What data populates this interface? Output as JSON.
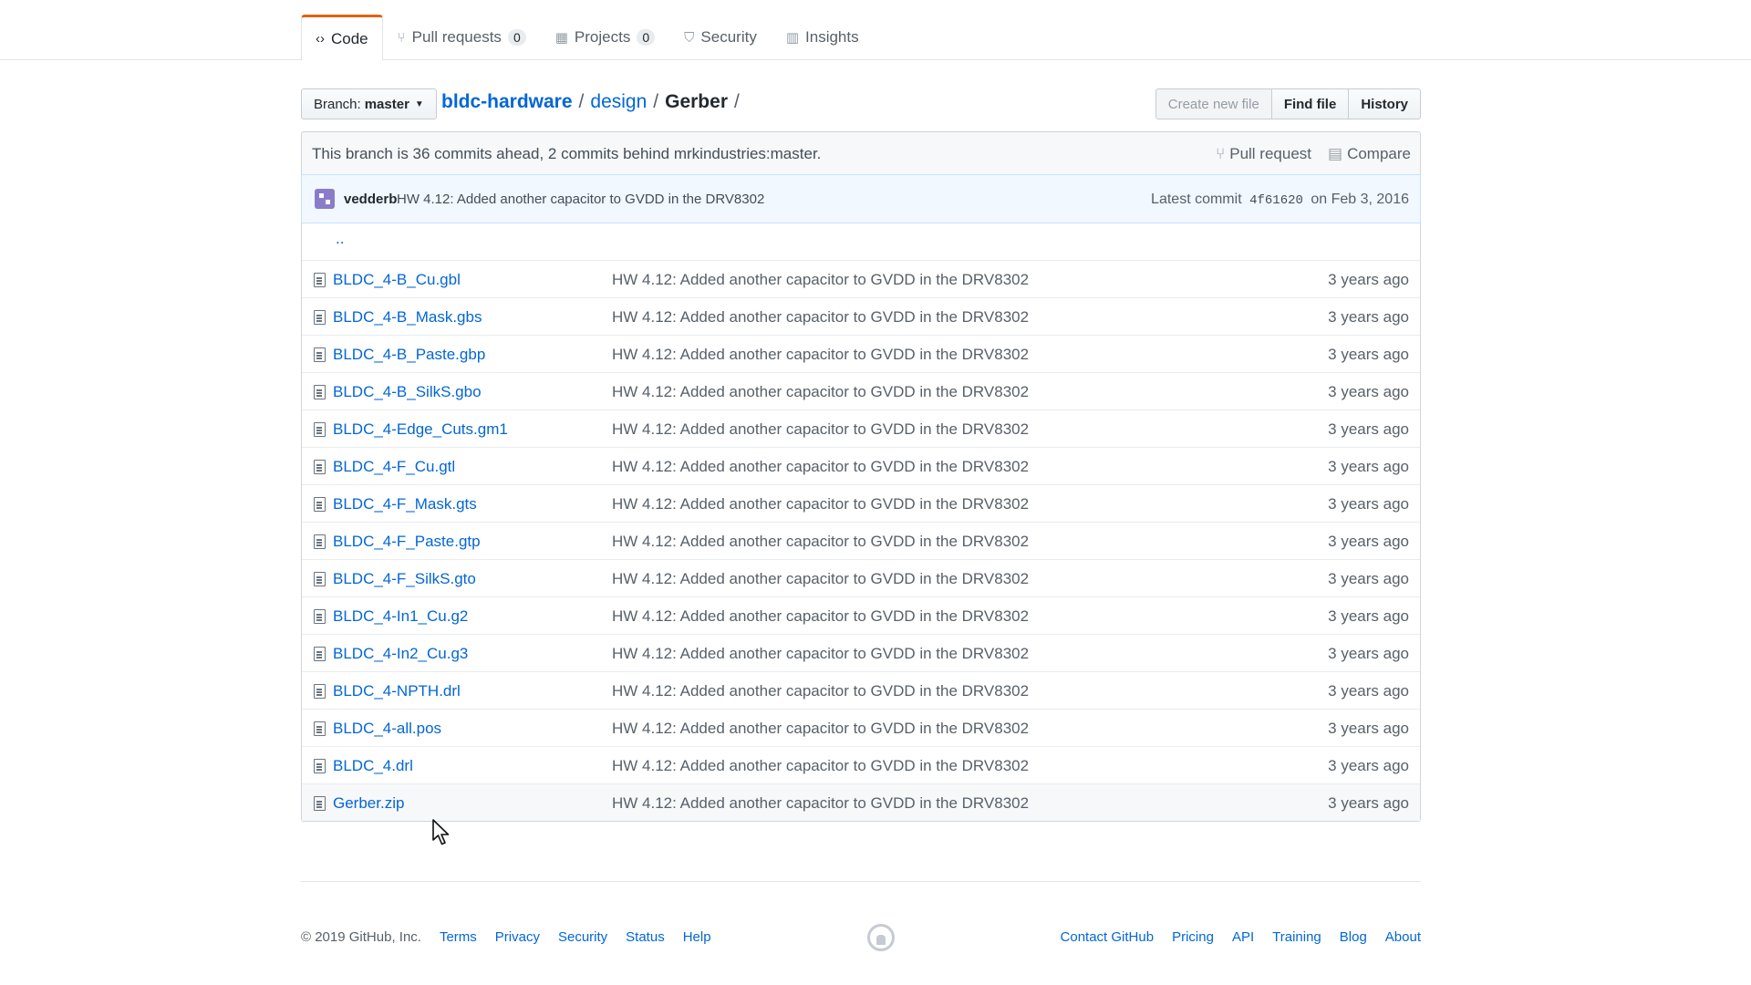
{
  "nav": {
    "tabs": [
      {
        "label": "Code",
        "icon": "code-icon",
        "glyph": "‹›"
      },
      {
        "label": "Pull requests",
        "count": "0",
        "icon": "pull-request-icon",
        "glyph": "⑂"
      },
      {
        "label": "Projects",
        "count": "0",
        "icon": "project-icon",
        "glyph": "▦"
      },
      {
        "label": "Security",
        "icon": "shield-icon",
        "glyph": "⛉"
      },
      {
        "label": "Insights",
        "icon": "graph-icon",
        "glyph": "▥"
      }
    ]
  },
  "file_nav": {
    "branch_prefix": "Branch:",
    "branch_name": "master",
    "breadcrumb": {
      "repo": "bldc-hardware",
      "folder": "design",
      "current": "Gerber",
      "separator": "/"
    },
    "buttons": {
      "create": "Create new file",
      "find": "Find file",
      "history": "History"
    }
  },
  "branch_info": {
    "message": "This branch is 36 commits ahead, 2 commits behind mrkindustries:master.",
    "pull_request": "Pull request",
    "compare": "Compare"
  },
  "commit": {
    "author": "vedderb",
    "message": "HW 4.12: Added another capacitor to GVDD in the DRV8302",
    "latest_label": "Latest commit",
    "sha": "4f61620",
    "date": "on Feb 3, 2016"
  },
  "parent_dir": "..",
  "files": [
    {
      "name": "BLDC_4-B_Cu.gbl",
      "message": "HW 4.12: Added another capacitor to GVDD in the DRV8302",
      "age": "3 years ago"
    },
    {
      "name": "BLDC_4-B_Mask.gbs",
      "message": "HW 4.12: Added another capacitor to GVDD in the DRV8302",
      "age": "3 years ago"
    },
    {
      "name": "BLDC_4-B_Paste.gbp",
      "message": "HW 4.12: Added another capacitor to GVDD in the DRV8302",
      "age": "3 years ago"
    },
    {
      "name": "BLDC_4-B_SilkS.gbo",
      "message": "HW 4.12: Added another capacitor to GVDD in the DRV8302",
      "age": "3 years ago"
    },
    {
      "name": "BLDC_4-Edge_Cuts.gm1",
      "message": "HW 4.12: Added another capacitor to GVDD in the DRV8302",
      "age": "3 years ago"
    },
    {
      "name": "BLDC_4-F_Cu.gtl",
      "message": "HW 4.12: Added another capacitor to GVDD in the DRV8302",
      "age": "3 years ago"
    },
    {
      "name": "BLDC_4-F_Mask.gts",
      "message": "HW 4.12: Added another capacitor to GVDD in the DRV8302",
      "age": "3 years ago"
    },
    {
      "name": "BLDC_4-F_Paste.gtp",
      "message": "HW 4.12: Added another capacitor to GVDD in the DRV8302",
      "age": "3 years ago"
    },
    {
      "name": "BLDC_4-F_SilkS.gto",
      "message": "HW 4.12: Added another capacitor to GVDD in the DRV8302",
      "age": "3 years ago"
    },
    {
      "name": "BLDC_4-In1_Cu.g2",
      "message": "HW 4.12: Added another capacitor to GVDD in the DRV8302",
      "age": "3 years ago"
    },
    {
      "name": "BLDC_4-In2_Cu.g3",
      "message": "HW 4.12: Added another capacitor to GVDD in the DRV8302",
      "age": "3 years ago"
    },
    {
      "name": "BLDC_4-NPTH.drl",
      "message": "HW 4.12: Added another capacitor to GVDD in the DRV8302",
      "age": "3 years ago"
    },
    {
      "name": "BLDC_4-all.pos",
      "message": "HW 4.12: Added another capacitor to GVDD in the DRV8302",
      "age": "3 years ago"
    },
    {
      "name": "BLDC_4.drl",
      "message": "HW 4.12: Added another capacitor to GVDD in the DRV8302",
      "age": "3 years ago"
    },
    {
      "name": "Gerber.zip",
      "message": "HW 4.12: Added another capacitor to GVDD in the DRV8302",
      "age": "3 years ago"
    }
  ],
  "footer": {
    "copyright": "© 2019 GitHub, Inc.",
    "left_links": [
      "Terms",
      "Privacy",
      "Security",
      "Status",
      "Help"
    ],
    "right_links": [
      "Contact GitHub",
      "Pricing",
      "API",
      "Training",
      "Blog",
      "About"
    ]
  },
  "colors": {
    "link": "#0366d6",
    "tab_accent": "#e36209",
    "commit_bg": "#f1f8ff"
  }
}
